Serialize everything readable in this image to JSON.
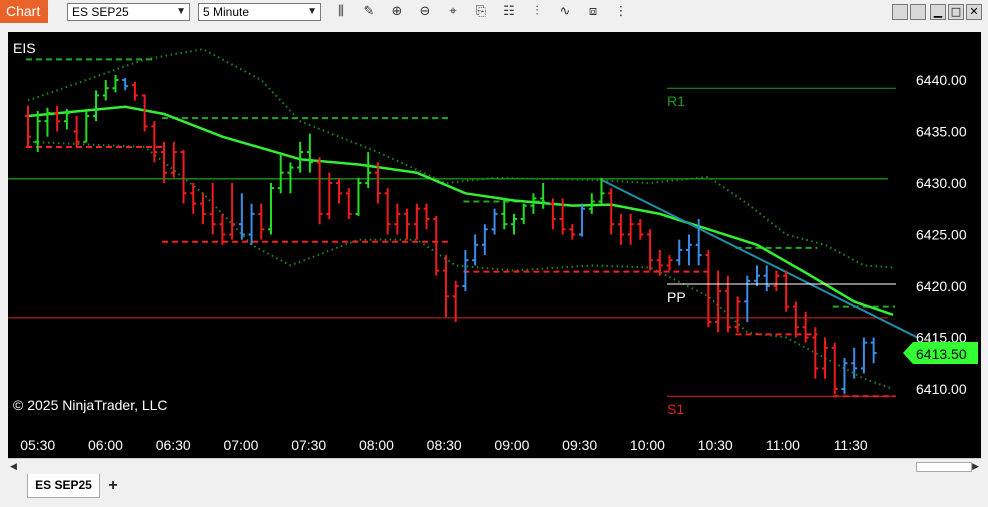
{
  "toolbar": {
    "chart_label": "Chart",
    "instrument": "ES SEP25",
    "interval": "5 Minute",
    "icons": [
      "bar-type-icon",
      "drawing-pencil-icon",
      "zoom-in-icon",
      "zoom-out-icon",
      "crosshair-icon",
      "data-box-icon",
      "properties-icon",
      "strategies-icon",
      "indicators-icon",
      "templates-icon",
      "more-tools-icon"
    ]
  },
  "window_controls": {
    "minimize": "▁",
    "maximize": "□",
    "close": "✕"
  },
  "chart": {
    "instrument_label": "EIS",
    "copyright": "© 2025 NinjaTrader, LLC",
    "current_price": "6413.50",
    "price_ticks": [
      "6440.00",
      "6435.00",
      "6430.00",
      "6425.00",
      "6420.00",
      "6415.00",
      "6410.00"
    ],
    "time_ticks": [
      "05:30",
      "06:00",
      "06:30",
      "07:00",
      "07:30",
      "08:00",
      "08:30",
      "09:00",
      "09:30",
      "10:00",
      "10:30",
      "11:00",
      "11:30"
    ],
    "pivot_labels": {
      "r1": "R1",
      "pp": "PP",
      "s1": "S1"
    },
    "colors": {
      "up": "#22dd22",
      "down": "#ee1c1c",
      "neutral": "#3a8ee8",
      "ma": "#33ee33",
      "price_tag": "#33ff33"
    }
  },
  "chart_data": {
    "type": "candlestick",
    "ylim": [
      6407,
      6443
    ],
    "pivots": {
      "R1": 6439.2,
      "PP": 6420.2,
      "S1": 6409.3
    },
    "reference_lines": [
      6430.4,
      6416.9
    ],
    "bars": [
      [
        6436.5,
        6437.5,
        6433.5,
        6434.5,
        "d"
      ],
      [
        6434.0,
        6437.0,
        6433.0,
        6436.0,
        "u"
      ],
      [
        6436.0,
        6437.3,
        6434.5,
        6436.8,
        "u"
      ],
      [
        6436.8,
        6437.5,
        6435.0,
        6436.0,
        "d"
      ],
      [
        6436.0,
        6437.2,
        6435.2,
        6436.8,
        "u"
      ],
      [
        6435.0,
        6436.5,
        6433.5,
        6434.0,
        "d"
      ],
      [
        6434.0,
        6437.0,
        6434.0,
        6436.5,
        "u"
      ],
      [
        6436.5,
        6439.0,
        6436.0,
        6438.5,
        "u"
      ],
      [
        6438.5,
        6440.0,
        6438.0,
        6439.2,
        "u"
      ],
      [
        6439.2,
        6440.5,
        6438.8,
        6440.0,
        "u"
      ],
      [
        6440.0,
        6440.2,
        6439.0,
        6439.4,
        "n"
      ],
      [
        6439.5,
        6439.8,
        6438.0,
        6438.5,
        "d"
      ],
      [
        6438.5,
        6438.6,
        6435.0,
        6435.5,
        "d"
      ],
      [
        6435.5,
        6436.0,
        6432.0,
        6433.0,
        "d"
      ],
      [
        6433.0,
        6434.0,
        6430.0,
        6431.0,
        "d"
      ],
      [
        6431.0,
        6434.0,
        6430.5,
        6433.0,
        "d"
      ],
      [
        6433.0,
        6433.2,
        6428.0,
        6429.0,
        "d"
      ],
      [
        6429.0,
        6430.0,
        6427.0,
        6428.0,
        "d"
      ],
      [
        6428.0,
        6429.0,
        6426.0,
        6427.0,
        "d"
      ],
      [
        6427.0,
        6430.0,
        6425.0,
        6426.0,
        "d"
      ],
      [
        6426.0,
        6427.0,
        6424.0,
        6425.0,
        "d"
      ],
      [
        6425.0,
        6430.0,
        6424.5,
        6426.0,
        "d"
      ],
      [
        6426.0,
        6429.0,
        6424.5,
        6425.0,
        "n"
      ],
      [
        6425.0,
        6428.0,
        6424.0,
        6427.0,
        "n"
      ],
      [
        6427.0,
        6428.0,
        6424.5,
        6425.5,
        "d"
      ],
      [
        6425.5,
        6430.0,
        6425.0,
        6429.5,
        "u"
      ],
      [
        6429.5,
        6433.0,
        6429.0,
        6431.0,
        "u"
      ],
      [
        6431.0,
        6432.0,
        6429.0,
        6431.5,
        "u"
      ],
      [
        6431.5,
        6434.0,
        6431.0,
        6433.0,
        "u"
      ],
      [
        6433.0,
        6434.8,
        6431.0,
        6432.0,
        "u"
      ],
      [
        6432.0,
        6432.5,
        6426.0,
        6427.0,
        "d"
      ],
      [
        6427.0,
        6431.0,
        6426.5,
        6430.0,
        "d"
      ],
      [
        6430.0,
        6430.5,
        6428.0,
        6429.0,
        "d"
      ],
      [
        6429.0,
        6429.5,
        6426.5,
        6427.0,
        "d"
      ],
      [
        6427.0,
        6430.5,
        6426.8,
        6430.0,
        "u"
      ],
      [
        6430.0,
        6433.0,
        6429.5,
        6431.0,
        "u"
      ],
      [
        6431.0,
        6432.0,
        6428.0,
        6429.0,
        "d"
      ],
      [
        6429.0,
        6429.5,
        6425.0,
        6426.0,
        "d"
      ],
      [
        6426.0,
        6428.0,
        6425.0,
        6427.0,
        "d"
      ],
      [
        6427.0,
        6427.5,
        6424.5,
        6426.0,
        "d"
      ],
      [
        6426.0,
        6428.0,
        6424.5,
        6427.5,
        "d"
      ],
      [
        6427.5,
        6428.0,
        6425.5,
        6426.5,
        "d"
      ],
      [
        6426.5,
        6426.8,
        6421.0,
        6421.5,
        "d"
      ],
      [
        6421.5,
        6423.0,
        6417.0,
        6419.0,
        "d"
      ],
      [
        6419.0,
        6420.5,
        6416.5,
        6420.0,
        "d"
      ],
      [
        6420.0,
        6423.5,
        6419.5,
        6422.5,
        "n"
      ],
      [
        6422.5,
        6425.0,
        6422.0,
        6424.0,
        "n"
      ],
      [
        6424.0,
        6426.0,
        6423.0,
        6425.5,
        "n"
      ],
      [
        6425.5,
        6427.5,
        6425.0,
        6427.0,
        "n"
      ],
      [
        6427.0,
        6428.5,
        6425.5,
        6426.0,
        "u"
      ],
      [
        6426.0,
        6427.0,
        6425.0,
        6426.5,
        "u"
      ],
      [
        6426.5,
        6428.0,
        6426.0,
        6427.8,
        "u"
      ],
      [
        6427.8,
        6429.0,
        6427.0,
        6428.5,
        "u"
      ],
      [
        6428.5,
        6430.0,
        6427.5,
        6428.0,
        "u"
      ],
      [
        6428.0,
        6428.5,
        6425.5,
        6426.5,
        "d"
      ],
      [
        6426.5,
        6428.5,
        6425.0,
        6425.5,
        "d"
      ],
      [
        6425.5,
        6426.0,
        6424.5,
        6425.0,
        "d"
      ],
      [
        6425.0,
        6428.0,
        6424.8,
        6427.5,
        "n"
      ],
      [
        6427.5,
        6429.0,
        6427.0,
        6428.2,
        "u"
      ],
      [
        6428.2,
        6430.5,
        6428.0,
        6429.0,
        "u"
      ],
      [
        6429.0,
        6429.5,
        6425.0,
        6426.0,
        "d"
      ],
      [
        6426.0,
        6427.0,
        6424.0,
        6425.0,
        "d"
      ],
      [
        6425.0,
        6427.0,
        6424.0,
        6426.0,
        "d"
      ],
      [
        6426.0,
        6426.5,
        6424.5,
        6425.0,
        "d"
      ],
      [
        6425.0,
        6425.5,
        6421.5,
        6422.5,
        "d"
      ],
      [
        6422.5,
        6423.5,
        6421.0,
        6422.0,
        "d"
      ],
      [
        6422.0,
        6423.0,
        6421.5,
        6422.5,
        "d"
      ],
      [
        6422.5,
        6424.5,
        6422.0,
        6423.5,
        "n"
      ],
      [
        6423.5,
        6425.0,
        6422.0,
        6424.0,
        "n"
      ],
      [
        6424.0,
        6426.5,
        6422.0,
        6423.0,
        "n"
      ],
      [
        6423.0,
        6423.5,
        6416.0,
        6416.5,
        "d"
      ],
      [
        6416.5,
        6421.5,
        6415.5,
        6419.5,
        "d"
      ],
      [
        6419.5,
        6421.0,
        6415.5,
        6416.0,
        "d"
      ],
      [
        6416.0,
        6419.0,
        6415.5,
        6418.5,
        "d"
      ],
      [
        6418.5,
        6421.0,
        6416.5,
        6420.5,
        "n"
      ],
      [
        6420.5,
        6422.0,
        6420.0,
        6421.0,
        "n"
      ],
      [
        6421.0,
        6422.0,
        6419.5,
        6420.0,
        "n"
      ],
      [
        6420.0,
        6421.5,
        6419.5,
        6421.0,
        "d"
      ],
      [
        6421.0,
        6421.5,
        6417.5,
        6418.0,
        "d"
      ],
      [
        6418.0,
        6418.5,
        6415.0,
        6416.0,
        "d"
      ],
      [
        6416.0,
        6417.5,
        6414.5,
        6415.0,
        "d"
      ],
      [
        6415.0,
        6416.0,
        6411.0,
        6412.0,
        "d"
      ],
      [
        6412.0,
        6415.0,
        6411.0,
        6414.0,
        "d"
      ],
      [
        6414.0,
        6414.5,
        6409.5,
        6410.0,
        "d"
      ],
      [
        6410.0,
        6413.0,
        6409.5,
        6412.5,
        "n"
      ],
      [
        6412.5,
        6414.0,
        6411.0,
        6412.0,
        "n"
      ],
      [
        6412.0,
        6415.0,
        6411.5,
        6414.5,
        "n"
      ],
      [
        6414.5,
        6415.0,
        6412.5,
        6413.5,
        "n"
      ]
    ],
    "moving_average": [
      [
        0,
        6436.5
      ],
      [
        10,
        6437.4
      ],
      [
        14,
        6436.7
      ],
      [
        20,
        6434.5
      ],
      [
        28,
        6432.3
      ],
      [
        34,
        6431.8
      ],
      [
        40,
        6431.0
      ],
      [
        45,
        6429.0
      ],
      [
        50,
        6428.3
      ],
      [
        56,
        6427.8
      ],
      [
        60,
        6427.9
      ],
      [
        65,
        6427.0
      ],
      [
        70,
        6425.5
      ],
      [
        75,
        6424.0
      ],
      [
        80,
        6421.3
      ],
      [
        85,
        6418.5
      ],
      [
        89,
        6417.2
      ]
    ],
    "bollinger_upper": [
      [
        0,
        6438.0
      ],
      [
        12,
        6442.0
      ],
      [
        18,
        6443.0
      ],
      [
        24,
        6440.0
      ],
      [
        28,
        6436.0
      ],
      [
        36,
        6433.0
      ],
      [
        43,
        6430.0
      ],
      [
        48,
        6430.5
      ],
      [
        58,
        6430.3
      ],
      [
        64,
        6430.0
      ],
      [
        70,
        6430.6
      ],
      [
        74,
        6428.0
      ],
      [
        78,
        6425.0
      ],
      [
        82,
        6424.0
      ],
      [
        86,
        6422.0
      ],
      [
        89,
        6421.8
      ]
    ],
    "bollinger_lower": [
      [
        0,
        6434.0
      ],
      [
        12,
        6433.5
      ],
      [
        18,
        6429.0
      ],
      [
        23,
        6424.0
      ],
      [
        27,
        6422.0
      ],
      [
        34,
        6424.5
      ],
      [
        40,
        6424.5
      ],
      [
        44,
        6422.0
      ],
      [
        50,
        6421.5
      ],
      [
        58,
        6422.0
      ],
      [
        64,
        6421.8
      ],
      [
        70,
        6419.0
      ],
      [
        74,
        6415.5
      ],
      [
        78,
        6415.0
      ],
      [
        82,
        6413.0
      ],
      [
        86,
        6411.0
      ],
      [
        89,
        6410.0
      ]
    ],
    "trendline": [
      [
        59,
        6430.3
      ],
      [
        90,
        6415.8
      ]
    ],
    "horizontal_segments": [
      {
        "from": 0,
        "to": 13,
        "y": 6442.0,
        "color": "up"
      },
      {
        "from": 0,
        "to": 14,
        "y": 6433.5,
        "color": "down"
      },
      {
        "from": 14,
        "to": 43,
        "y": 6436.3,
        "color": "up"
      },
      {
        "from": 14,
        "to": 43,
        "y": 6424.3,
        "color": "down"
      },
      {
        "from": 45,
        "to": 53,
        "y": 6428.2,
        "color": "up"
      },
      {
        "from": 45,
        "to": 70,
        "y": 6421.4,
        "color": "down"
      },
      {
        "from": 73,
        "to": 81,
        "y": 6423.7,
        "color": "up"
      },
      {
        "from": 73,
        "to": 81,
        "y": 6415.3,
        "color": "down"
      },
      {
        "from": 83,
        "to": 89,
        "y": 6418.0,
        "color": "up"
      },
      {
        "from": 83,
        "to": 89,
        "y": 6409.3,
        "color": "down"
      }
    ]
  }
}
